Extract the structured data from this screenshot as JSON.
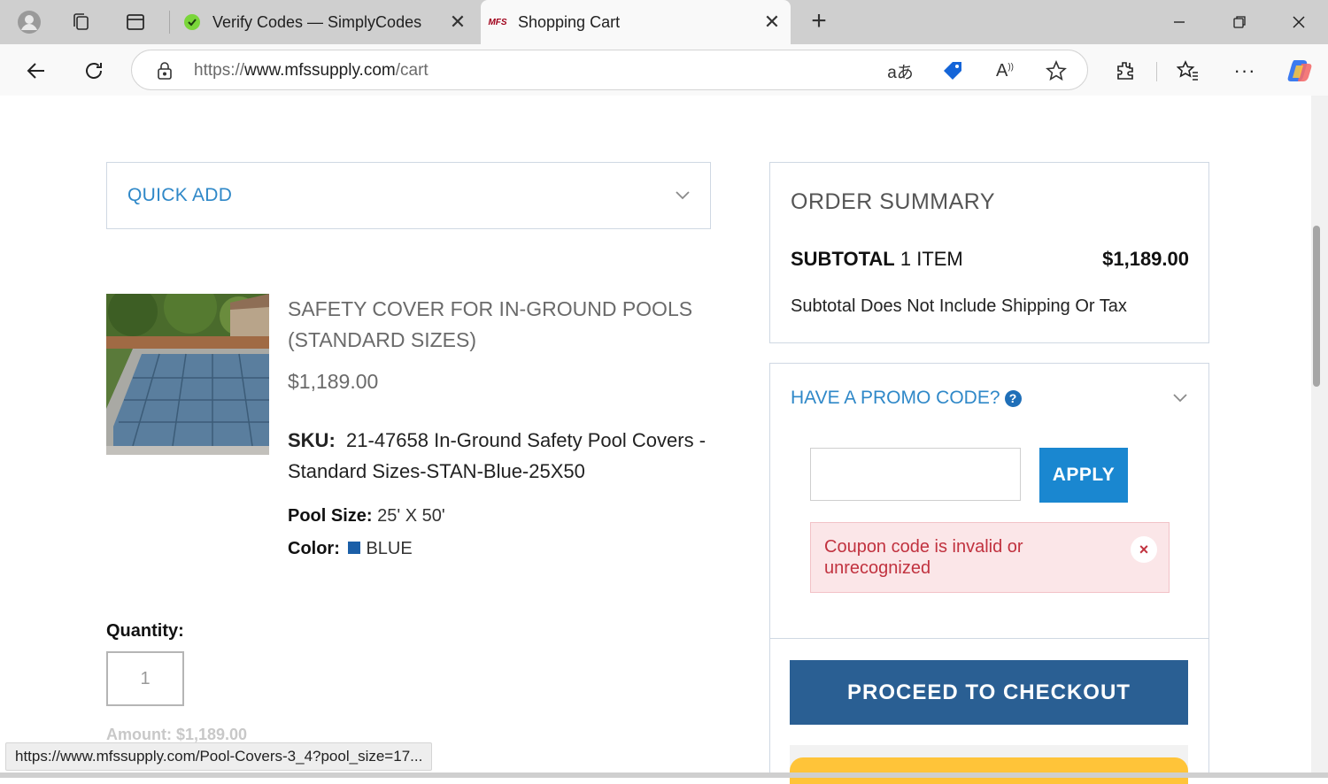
{
  "browser": {
    "tabs": [
      {
        "title": "Verify Codes — SimplyCodes",
        "active": false,
        "favicon": "simplycodes-icon"
      },
      {
        "title": "Shopping Cart",
        "active": true,
        "favicon": "mfs-logo",
        "favicon_text": "MFS"
      }
    ],
    "url": {
      "scheme": "https://",
      "host": "www.mfssupply.com",
      "path": "/cart"
    },
    "status_url": "https://www.mfssupply.com/Pool-Covers-3_4?pool_size=17..."
  },
  "quick_add": {
    "label": "QUICK ADD"
  },
  "product": {
    "title": "SAFETY COVER FOR IN-GROUND POOLS (STANDARD SIZES)",
    "price": "$1,189.00",
    "sku_label": "SKU:",
    "sku_value": "21-47658 In-Ground Safety Pool Covers - Standard Sizes-STAN-Blue-25X50",
    "pool_size_label": "Pool Size:",
    "pool_size_value": "25' X 50'",
    "color_label": "Color:",
    "color_value": "BLUE",
    "color_hex": "#1b5fa8",
    "quantity_label": "Quantity:",
    "quantity_value": "1",
    "amount": "Amount: $1,189.00"
  },
  "summary": {
    "heading": "ORDER SUMMARY",
    "subtotal_label": "SUBTOTAL",
    "item_count": "1 ITEM",
    "subtotal_value": "$1,189.00",
    "note": "Subtotal Does Not Include Shipping Or Tax"
  },
  "promo": {
    "heading": "HAVE A PROMO CODE?",
    "help_glyph": "?",
    "input_value": "",
    "apply_label": "APPLY",
    "error_message": "Coupon code is invalid or unrecognized",
    "error_close": "×"
  },
  "checkout": {
    "label": "PROCEED TO CHECKOUT"
  },
  "colors": {
    "accent": "#2f88c8",
    "apply": "#1a87d0",
    "checkout": "#2a5f93",
    "error": "#c1323f",
    "paypal": "#ffc439"
  }
}
